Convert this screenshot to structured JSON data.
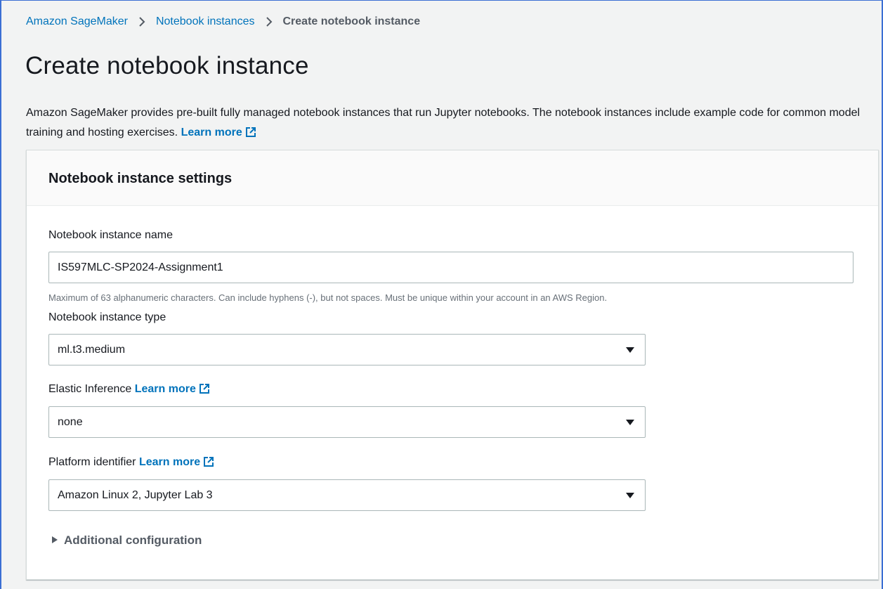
{
  "breadcrumb": {
    "items": [
      "Amazon SageMaker",
      "Notebook instances"
    ],
    "current": "Create notebook instance"
  },
  "page": {
    "title": "Create notebook instance",
    "description": "Amazon SageMaker provides pre-built fully managed notebook instances that run Jupyter notebooks. The notebook instances include example code for common model training and hosting exercises.",
    "learn_more": "Learn more"
  },
  "settings": {
    "title": "Notebook instance settings",
    "name_label": "Notebook instance name",
    "name_value": "IS597MLC-SP2024-Assignment1",
    "name_hint": "Maximum of 63 alphanumeric characters. Can include hyphens (-), but not spaces. Must be unique within your account in an AWS Region.",
    "type_label": "Notebook instance type",
    "type_value": "ml.t3.medium",
    "elastic_label": "Elastic Inference",
    "elastic_learn_more": "Learn more",
    "elastic_value": "none",
    "platform_label": "Platform identifier",
    "platform_learn_more": "Learn more",
    "platform_value": "Amazon Linux 2, Jupyter Lab 3",
    "additional_config": "Additional configuration"
  },
  "colors": {
    "link": "#0073bb",
    "text": "#16191f",
    "muted": "#687078",
    "background": "#f2f3f3",
    "panel": "#ffffff",
    "input_border": "#aab7b8"
  },
  "icons": [
    "chevron-right-icon",
    "external-link-icon",
    "caret-down-icon",
    "caret-right-icon"
  ]
}
